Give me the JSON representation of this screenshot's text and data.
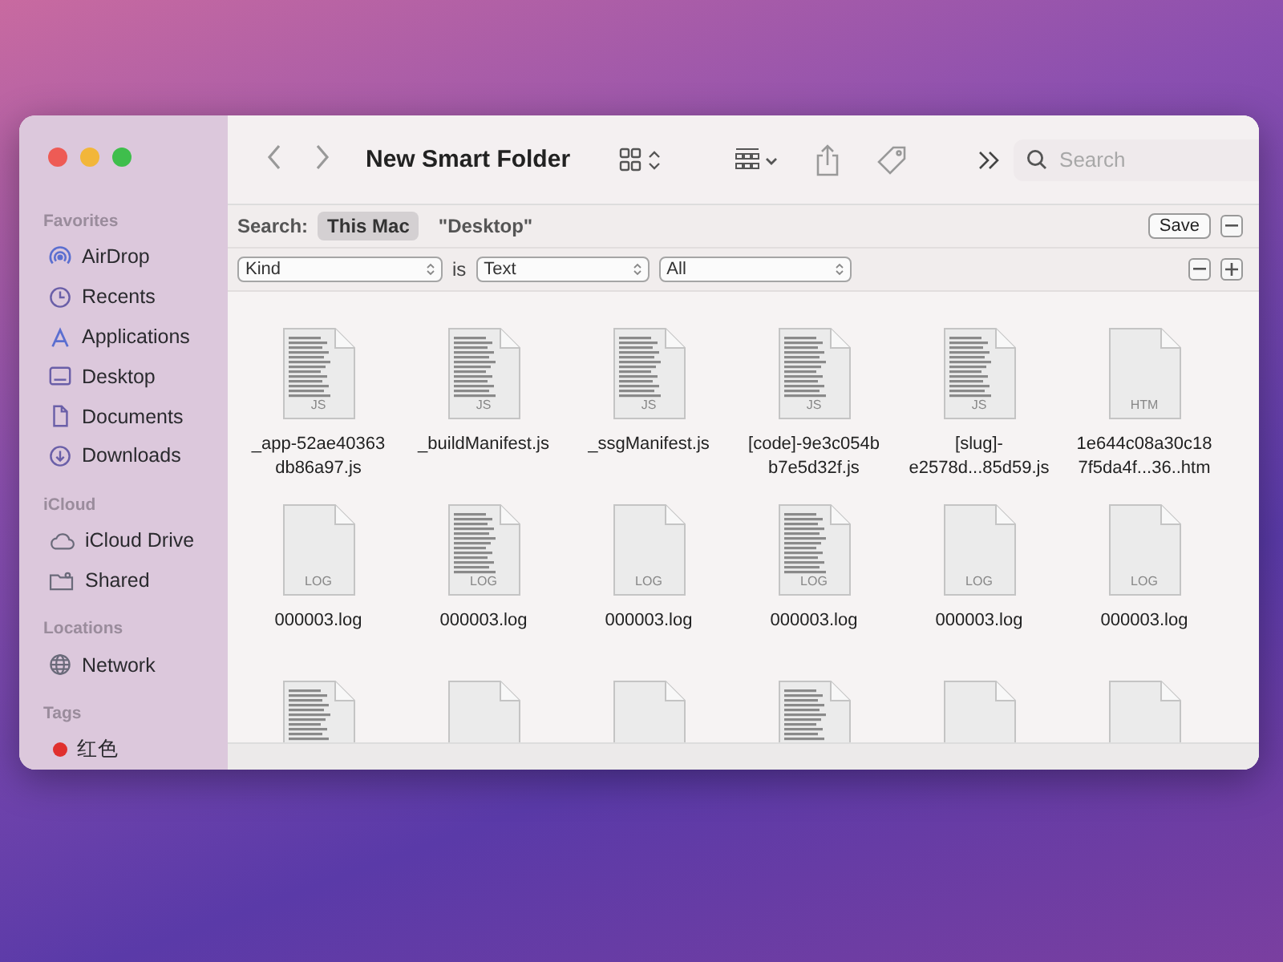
{
  "window": {
    "title": "New Smart Folder"
  },
  "sidebar": {
    "sections": [
      {
        "heading": "Favorites",
        "items": [
          {
            "label": "AirDrop",
            "kind": "airdrop"
          },
          {
            "label": "Recents",
            "kind": "clock"
          },
          {
            "label": "Applications",
            "kind": "apps"
          },
          {
            "label": "Desktop",
            "kind": "desktop"
          },
          {
            "label": "Documents",
            "kind": "document"
          },
          {
            "label": "Downloads",
            "kind": "download"
          }
        ]
      },
      {
        "heading": "iCloud",
        "items": [
          {
            "label": "iCloud Drive",
            "kind": "cloud"
          },
          {
            "label": "Shared",
            "kind": "shared"
          }
        ]
      },
      {
        "heading": "Locations",
        "items": [
          {
            "label": "Network",
            "kind": "globe"
          }
        ]
      },
      {
        "heading": "Tags",
        "items": [
          {
            "label": "红色",
            "kind": "tag",
            "color": "#e0302e"
          }
        ]
      }
    ]
  },
  "toolbar": {
    "search": {
      "placeholder": "Search"
    }
  },
  "search_scope": {
    "label": "Search:",
    "options": [
      {
        "label": "This Mac",
        "selected": true
      },
      {
        "label": "\"Desktop\"",
        "selected": false
      }
    ],
    "save": "Save"
  },
  "criteria": {
    "attribute": "Kind",
    "operator": "is",
    "value": "Text",
    "subvalue": "All"
  },
  "files": [
    {
      "name": "_app-52ae40363 db86a97.js",
      "badge": "JS",
      "preview": true
    },
    {
      "name": "_buildManifest.js",
      "badge": "JS",
      "preview": true
    },
    {
      "name": "_ssgManifest.js",
      "badge": "JS",
      "preview": true
    },
    {
      "name": "[code]-9e3c054b b7e5d32f.js",
      "badge": "JS",
      "preview": true
    },
    {
      "name": "[slug]- e2578d...85d59.js",
      "badge": "JS",
      "preview": true
    },
    {
      "name": "1e644c08a30c18 7f5da4f...36..htm",
      "badge": "HTM",
      "preview": false
    },
    {
      "name": "000003.log",
      "badge": "LOG",
      "preview": false
    },
    {
      "name": "000003.log",
      "badge": "LOG",
      "preview": true
    },
    {
      "name": "000003.log",
      "badge": "LOG",
      "preview": false
    },
    {
      "name": "000003.log",
      "badge": "LOG",
      "preview": true
    },
    {
      "name": "000003.log",
      "badge": "LOG",
      "preview": false
    },
    {
      "name": "000003.log",
      "badge": "LOG",
      "preview": false
    },
    {
      "preview": true
    },
    {
      "preview": false
    },
    {
      "preview": false
    },
    {
      "preview": true
    },
    {
      "preview": false
    },
    {
      "preview": false
    }
  ]
}
